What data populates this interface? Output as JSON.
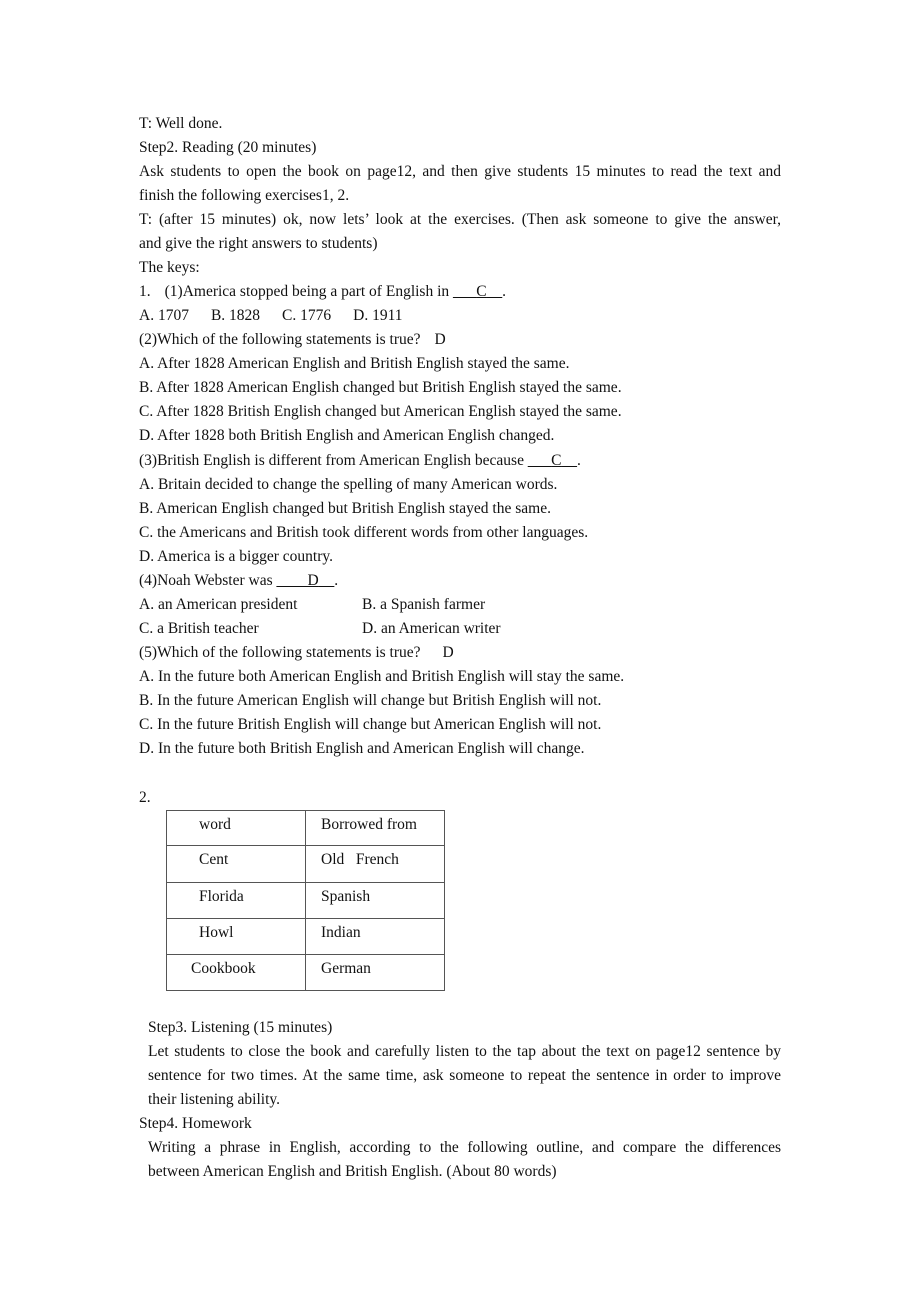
{
  "doc": {
    "well_done": "T: Well done.",
    "step2_title": "Step2. Reading (20 minutes)",
    "step2_para1_line1": "Ask students to open the book on page12, and then give students 15 minutes to read the text and",
    "step2_para1_line2": "finish the following exercises1, 2.",
    "step2_para2_line1": "T: (after 15 minutes) ok, now lets’ look at the exercises. (Then ask someone to give the answer,",
    "step2_para2_line2": "and give the right answers to students)",
    "keys_label": "The keys:",
    "ex1_number": "1.",
    "questions": [
      {
        "stem": "(1)America stopped being a part of English in ",
        "blank_pre": "___",
        "answer": "C",
        "blank_post": "__",
        "end": ".",
        "options_inline": [
          "A. 1707",
          "B. 1828",
          "C. 1776",
          "D. 1911"
        ]
      },
      {
        "stem": "(2)Which of the following statements is true?",
        "answer": "D",
        "options": [
          "A. After 1828 American English and British English stayed the same.",
          "B. After 1828 American English changed but British English stayed the same.",
          "C. After 1828 British English changed but American English stayed the same.",
          "D. After 1828 both British English and American English changed."
        ]
      },
      {
        "stem": "(3)British English is different from American English because ",
        "blank_pre": "___",
        "answer": "C",
        "blank_post": "__",
        "end": ".",
        "options": [
          "A. Britain decided to change the spelling of many American words.",
          "B. American English changed but British English stayed the same.",
          "C. the Americans and British took different words from other languages.",
          "D. America is a bigger country."
        ]
      },
      {
        "stem": "(4)Noah Webster was ",
        "blank_pre": "____",
        "answer": "D",
        "blank_post": "__",
        "end": ".",
        "options_grid": [
          "A. an American president",
          "B. a Spanish farmer",
          "C. a British teacher",
          "D. an American writer"
        ]
      },
      {
        "stem": "(5)Which of the following statements is true?",
        "answer": "D",
        "options": [
          "A. In the future both American English and British English will stay the same.",
          "B. In the future American English will change but British English will not.",
          "C. In the future British English will change but American English will not.",
          "D. In the future both British English and American English will change."
        ]
      }
    ],
    "ex2_number": "2.",
    "table": {
      "headers": [
        "word",
        "Borrowed from"
      ],
      "rows": [
        [
          "Cent",
          "Old   French"
        ],
        [
          "Florida",
          "Spanish"
        ],
        [
          "Howl",
          "Indian"
        ],
        [
          "Cookbook",
          "German"
        ]
      ]
    },
    "step3_title": "Step3. Listening (15 minutes)",
    "step3_line1": "Let students to close the book and carefully listen to the tap about the text on page12 sentence by",
    "step3_line2": "sentence for two times. At the same time, ask someone to repeat the sentence in order to improve",
    "step3_line3": "their listening ability.",
    "step4_title": "Step4. Homework",
    "step4_line1": "Writing a phrase in English, according to the following outline, and compare the differences",
    "step4_line2": "between American English and British English. (About 80 words)"
  }
}
